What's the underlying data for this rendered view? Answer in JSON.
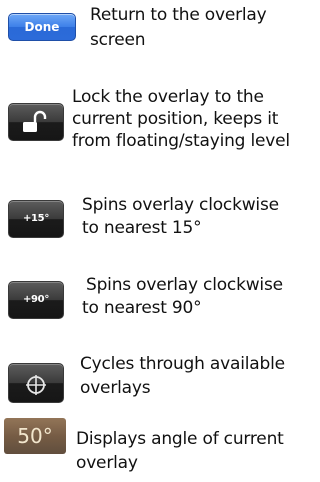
{
  "items": [
    {
      "button_label": "Done",
      "line1": "Return to the overlay",
      "line2": "screen"
    },
    {
      "icon": "unlock-icon",
      "line1": "Lock the overlay to the",
      "line2": "current position, keeps it",
      "line3": "from floating/staying level"
    },
    {
      "button_label": "+15°",
      "line1": "Spins overlay clockwise",
      "line2": "to nearest 15°"
    },
    {
      "button_label": "+90°",
      "line1": "Spins overlay clockwise",
      "line2": "to nearest 90°"
    },
    {
      "icon": "crosshair-icon",
      "line1": "Cycles through available",
      "line2": "overlays"
    },
    {
      "button_label": "50°",
      "line1": "Displays angle of current",
      "line2": "overlay"
    }
  ],
  "colors": {
    "done_blue": "#3d7fe8",
    "dark_button": "#1b1b1b",
    "angle_brown": "#6b4f36"
  }
}
